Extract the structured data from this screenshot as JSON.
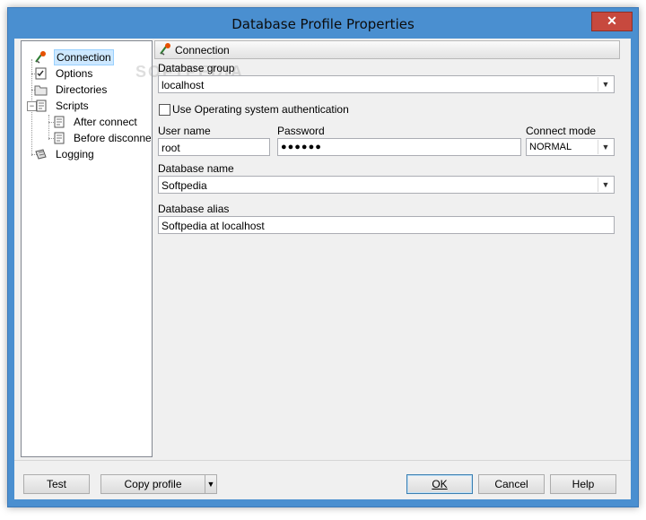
{
  "window": {
    "title": "Database Profile Properties",
    "close_glyph": "✕"
  },
  "tree": {
    "items": [
      {
        "label": "Connection"
      },
      {
        "label": "Options"
      },
      {
        "label": "Directories"
      },
      {
        "label": "Scripts"
      },
      {
        "label": "After connect"
      },
      {
        "label": "Before disconnect"
      },
      {
        "label": "Logging"
      }
    ]
  },
  "section": {
    "title": "Connection"
  },
  "form": {
    "database_group_label": "Database group",
    "database_group_value": "localhost",
    "os_auth_label": "Use Operating system authentication",
    "user_name_label": "User name",
    "user_name_value": "root",
    "password_label": "Password",
    "password_value": "●●●●●●",
    "connect_mode_label": "Connect mode",
    "connect_mode_value": "NORMAL",
    "database_name_label": "Database name",
    "database_name_value": "Softpedia",
    "database_alias_label": "Database alias",
    "database_alias_value": "Softpedia at localhost"
  },
  "watermark": "SOFTPEDIA",
  "buttons": {
    "test": "Test",
    "copy_profile": "Copy profile",
    "dropdown_glyph": "▼",
    "ok": "OK",
    "cancel": "Cancel",
    "help": "Help"
  }
}
